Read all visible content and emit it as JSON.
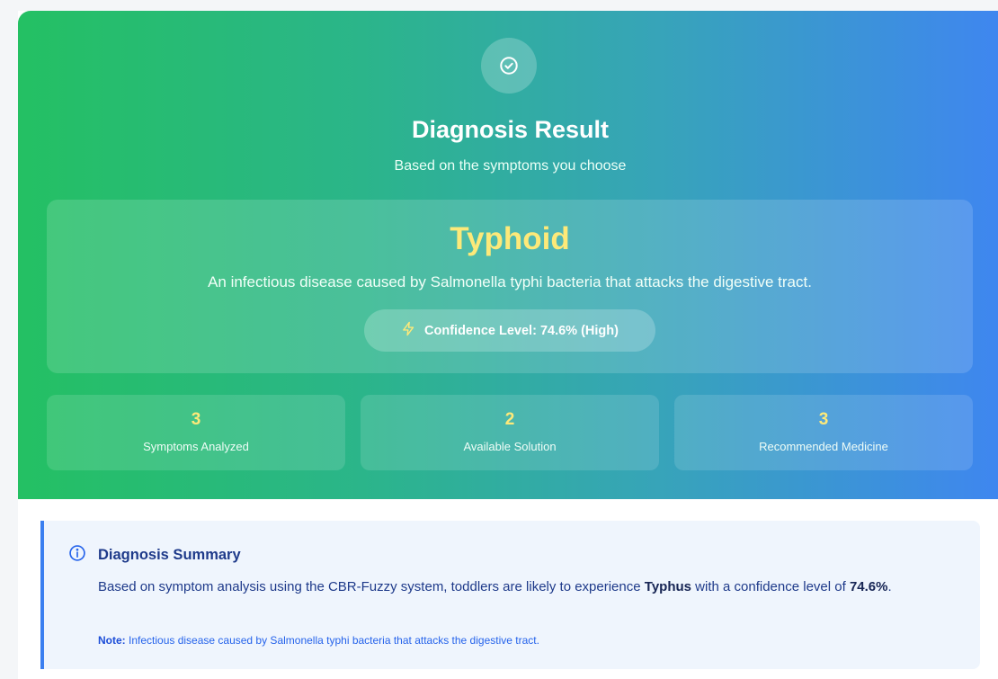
{
  "header": {
    "title": "Diagnosis Result",
    "subtitle": "Based on the symptoms you choose",
    "icon": "check-circle-icon"
  },
  "result": {
    "disease": "Typhoid",
    "description": "An infectious disease caused by Salmonella typhi bacteria that attacks the digestive tract.",
    "confidence_text": "Confidence Level: 74.6% (High)",
    "confidence_icon": "lightning-icon"
  },
  "stats": [
    {
      "value": "3",
      "label": "Symptoms Analyzed"
    },
    {
      "value": "2",
      "label": "Available Solution"
    },
    {
      "value": "3",
      "label": "Recommended Medicine"
    }
  ],
  "summary": {
    "icon": "info-icon",
    "title": "Diagnosis Summary",
    "text_prefix": "Based on symptom analysis using the CBR-Fuzzy system, toddlers are likely to experience ",
    "disease_highlight": "Typhus",
    "text_middle": " with a confidence level of ",
    "confidence_highlight": "74.6%",
    "text_suffix": ".",
    "note_label": "Note:",
    "note_text": " Infectious disease caused by Salmonella typhi bacteria that attacks the digestive tract."
  },
  "colors": {
    "gradient_start": "#24c063",
    "gradient_end": "#3f86f0",
    "highlight_yellow": "#fde979",
    "summary_accent": "#3b7ff0"
  }
}
